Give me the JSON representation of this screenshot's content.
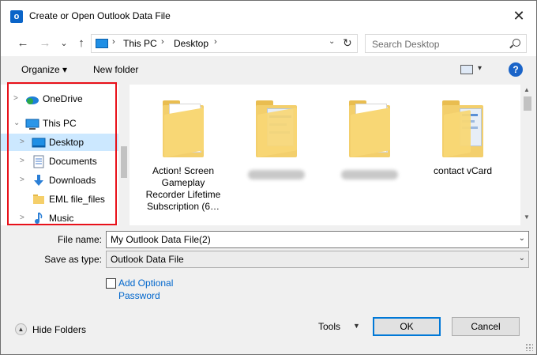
{
  "window": {
    "title": "Create or Open Outlook Data File",
    "app_icon_letter": "o",
    "close_glyph": "✕"
  },
  "nav": {
    "back_glyph": "←",
    "forward_glyph": "→",
    "recent_glyph": "⌄",
    "up_glyph": "↑",
    "breadcrumb": [
      "This PC",
      "Desktop"
    ],
    "breadcrumb_sep": "›",
    "search_placeholder": "Search Desktop"
  },
  "toolbar": {
    "organize_label": "Organize ▾",
    "new_folder_label": "New folder",
    "view_dd_glyph": "▾",
    "help_label": "?"
  },
  "tree": [
    {
      "label": "OneDrive",
      "chevron": ">",
      "icon": "onedrive-icon"
    },
    {
      "label": "This PC",
      "chevron": "⌄",
      "icon": "pc-icon"
    },
    {
      "label": "Desktop",
      "chevron": ">",
      "icon": "desktop-icon",
      "selected": true
    },
    {
      "label": "Documents",
      "chevron": ">",
      "icon": "document-icon"
    },
    {
      "label": "Downloads",
      "chevron": ">",
      "icon": "download-icon"
    },
    {
      "label": "EML file_files",
      "chevron": "",
      "icon": "folder-icon"
    },
    {
      "label": "Music",
      "chevron": ">",
      "icon": "music-icon"
    }
  ],
  "files": [
    {
      "label": "Action! Screen Gameplay Recorder Lifetime Subscription (6…",
      "kind": "folder"
    },
    {
      "label": "",
      "kind": "folder-with-thumbnail",
      "label_blurred": true
    },
    {
      "label": "",
      "kind": "folder",
      "label_blurred": true
    },
    {
      "label": "contact vCard",
      "kind": "folder-with-thumbnail"
    }
  ],
  "form": {
    "file_name_label": "File name:",
    "file_name_value": "My Outlook Data File(2)",
    "save_type_label": "Save as type:",
    "save_type_value": "Outlook Data File",
    "dd_glyph": "⌄",
    "optional_password_label": "Add Optional Password"
  },
  "footer": {
    "hide_folders_label": "Hide Folders",
    "hide_folders_glyph": "▲",
    "tools_label": "Tools",
    "tools_dd_glyph": "▼",
    "ok_label": "OK",
    "cancel_label": "Cancel"
  },
  "colors": {
    "selection": "#cce8ff",
    "highlight_box": "#e8111a",
    "link": "#0066cc",
    "primary_border": "#0078d7"
  }
}
